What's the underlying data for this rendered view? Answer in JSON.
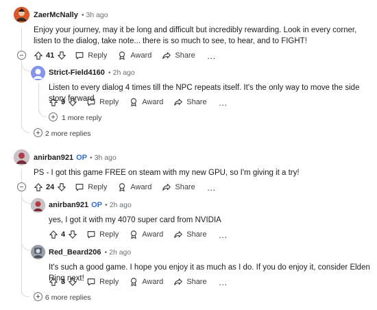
{
  "comments": {
    "zaer": {
      "author": "ZaerMcNally",
      "time": "3h ago",
      "text": "Enjoy your journey, may it be long and difficult but incredibly rewarding. Look in every corner, listen to the dialog, take note... there is so much to see, to hear, and to FIGHT!",
      "score": "41",
      "reply_label": "Reply",
      "award_label": "Award",
      "share_label": "Share",
      "more_replies": "2 more replies"
    },
    "strict": {
      "author": "Strict-Field4160",
      "time": "2h ago",
      "text": "Listen to every dialog 4 times till the NPC repeats itself. It's the only way to move the side story forward",
      "score": "9",
      "reply_label": "Reply",
      "award_label": "Award",
      "share_label": "Share",
      "more_replies": "1 more reply"
    },
    "anirban": {
      "author": "anirban921",
      "op_badge": "OP",
      "time": "3h ago",
      "text": "PS - I got this game FREE on steam with my new GPU, so I'm giving it a try!",
      "score": "24",
      "reply_label": "Reply",
      "award_label": "Award",
      "share_label": "Share",
      "more_replies": "6 more replies"
    },
    "anirban_reply": {
      "author": "anirban921",
      "op_badge": "OP",
      "time": "2h ago",
      "text": "yes, I got it with my 4070 super card from NVIDIA",
      "score": "4",
      "reply_label": "Reply",
      "award_label": "Award",
      "share_label": "Share"
    },
    "redbeard": {
      "author": "Red_Beard206",
      "time": "2h ago",
      "text": "It's such a good game. I hope you enjoy it as much as I do. If you do enjoy it, consider Elden Ring next!",
      "score": "3",
      "reply_label": "Reply",
      "award_label": "Award",
      "share_label": "Share"
    }
  },
  "separator": "•",
  "more_icon": "…",
  "collapse_icon": "−",
  "expand_icon": "+",
  "colors": {
    "op_badge": "#2d6fd1",
    "thread_line": "#d9dcdf",
    "strict_avatar": "#7f8fe8"
  }
}
